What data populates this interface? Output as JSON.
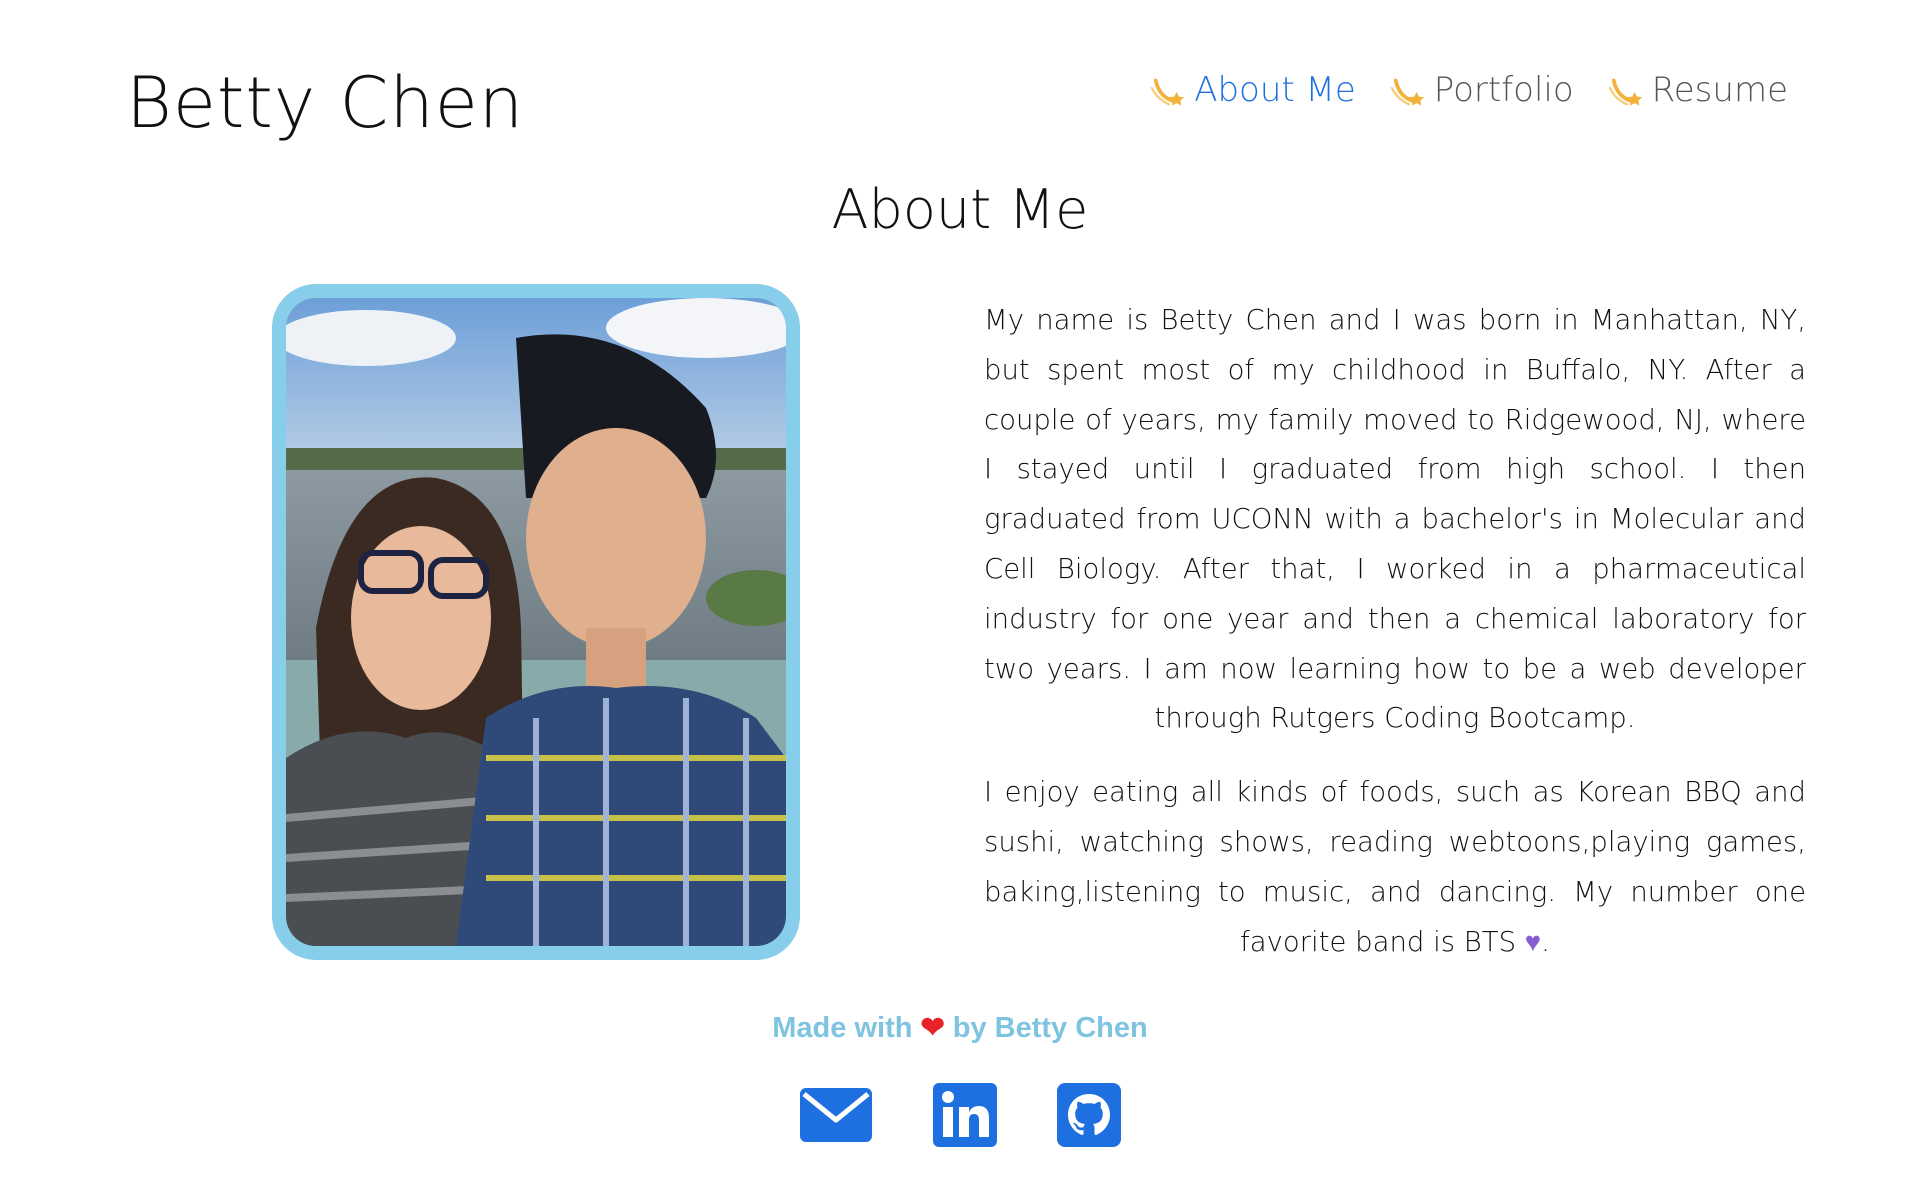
{
  "header": {
    "title": "Betty Chen",
    "nav": [
      {
        "label": "About Me",
        "active": true,
        "icon": "shooting-star-icon"
      },
      {
        "label": "Portfolio",
        "active": false,
        "icon": "shooting-star-icon"
      },
      {
        "label": "Resume",
        "active": false,
        "icon": "shooting-star-icon"
      }
    ]
  },
  "main": {
    "heading": "About Me",
    "photo": "couple-photo",
    "bio_paragraph_1": "My name is Betty Chen and I was born in Manhattan, NY, but spent most of my childhood in Buffalo, NY. After a couple of years, my family moved to Ridgewood, NJ, where I stayed until I graduated from high school. I then graduated from UCONN with a bachelor's in Molecular and Cell Biology. After that, I worked in a pharmaceutical industry for one year and then a chemical laboratory for two years. I am now learning how to be a web developer through Rutgers Coding Bootcamp.",
    "bio_paragraph_2_text": "I enjoy eating all kinds of foods, such as Korean BBQ and sushi, watching shows, reading webtoons,playing games, baking,listening to music, and dancing. My number one favorite band is BTS",
    "bio_paragraph_2_end": "."
  },
  "footer": {
    "made_with": "Made with",
    "by": "by Betty Chen",
    "social": [
      {
        "name": "email-icon"
      },
      {
        "name": "linkedin-icon"
      },
      {
        "name": "github-icon"
      }
    ]
  },
  "colors": {
    "accent_blue": "#1e6fe0",
    "frame_blue": "#87ceeb",
    "footer_text": "#7ec4e0",
    "heart_red": "#e8222a",
    "heart_purple": "#8a5cd1",
    "star_gold": "#f2b33d"
  }
}
